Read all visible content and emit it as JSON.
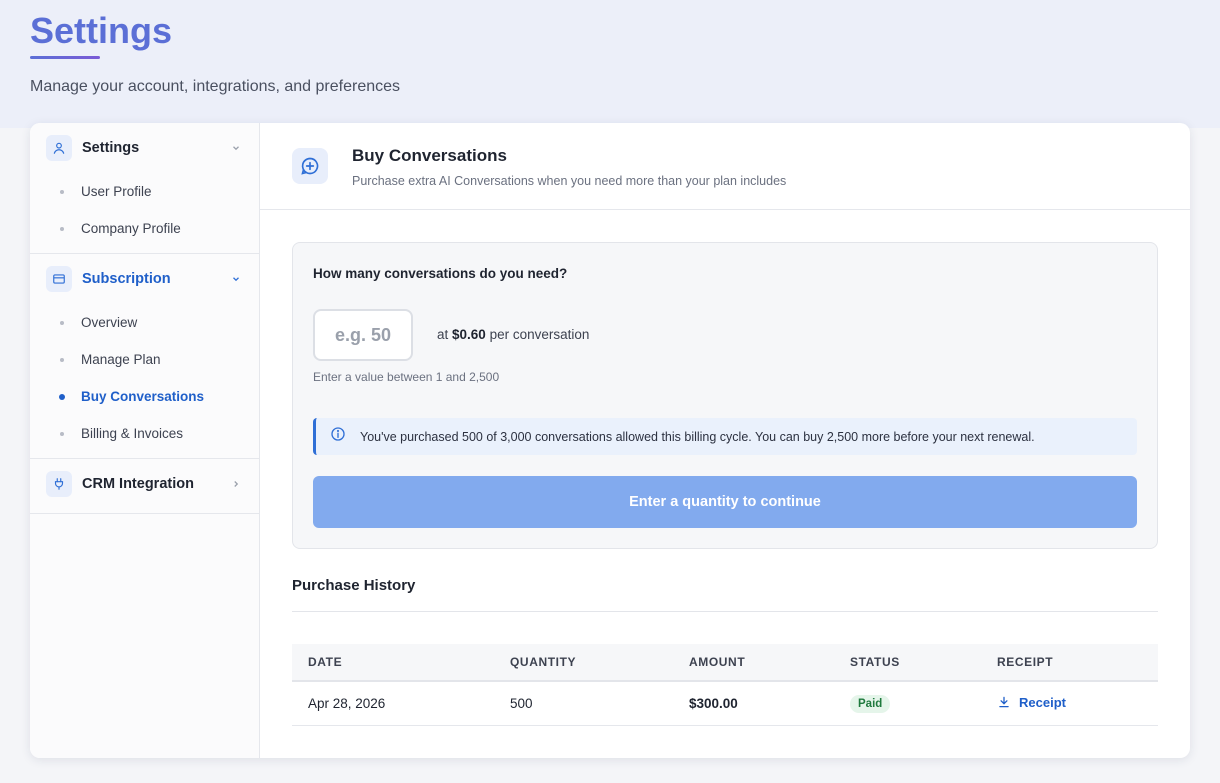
{
  "page": {
    "title": "Settings",
    "subtitle": "Manage your account, integrations, and preferences"
  },
  "sidebar": {
    "sections": [
      {
        "label": "Settings",
        "icon": "user-icon",
        "items": [
          "User Profile",
          "Company Profile"
        ]
      },
      {
        "label": "Subscription",
        "icon": "credit-card-icon",
        "items": [
          "Overview",
          "Manage Plan",
          "Buy Conversations",
          "Billing & Invoices"
        ],
        "active_item": "Buy Conversations"
      },
      {
        "label": "CRM Integration",
        "icon": "plug-icon",
        "items": []
      }
    ]
  },
  "header": {
    "title": "Buy Conversations",
    "subtitle": "Purchase extra AI Conversations when you need more than your plan includes",
    "icon": "chat-plus-icon"
  },
  "buy": {
    "question": "How many conversations do you need?",
    "placeholder": "e.g. 50",
    "price_prefix": "at ",
    "price": "$0.60",
    "price_suffix": " per conversation",
    "hint": "Enter a value between 1 and 2,500",
    "info": "You've purchased 500 of 3,000 conversations allowed this billing cycle. You can buy 2,500 more before your next renewal.",
    "cta": "Enter a quantity to continue"
  },
  "history": {
    "title": "Purchase History",
    "columns": [
      "DATE",
      "QUANTITY",
      "AMOUNT",
      "STATUS",
      "RECEIPT"
    ],
    "rows": [
      {
        "date": "Apr 28, 2026",
        "quantity": "500",
        "amount": "$300.00",
        "status": "Paid",
        "receipt": "Receipt"
      }
    ]
  },
  "colors": {
    "accent": "#1f5fc9",
    "title": "#5b6fd6",
    "cta_disabled": "#82aaee",
    "paid_badge": "#e5f5ea"
  }
}
